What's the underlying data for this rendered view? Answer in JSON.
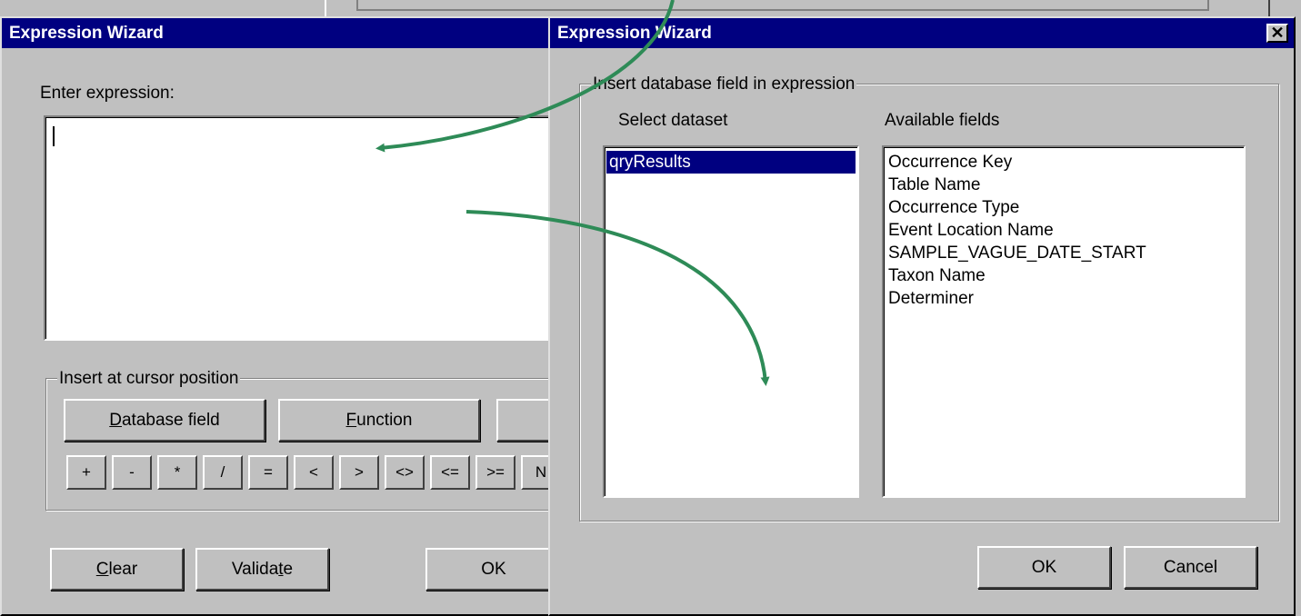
{
  "left_dialog": {
    "title": "Expression Wizard",
    "expression_label": "Enter expression:",
    "expression_value": "",
    "insert_group_caption": "Insert at cursor position",
    "database_field_button": {
      "pre": "",
      "accel": "D",
      "post": "atabase field"
    },
    "function_button": {
      "pre": "",
      "accel": "F",
      "post": "unction"
    },
    "operators": [
      "+",
      "-",
      "*",
      "/",
      "=",
      "<",
      ">",
      "<>",
      "<=",
      ">=",
      "N"
    ],
    "clear_button": {
      "pre": "",
      "accel": "C",
      "post": "lear"
    },
    "validate_button": {
      "pre": "Valida",
      "accel": "t",
      "post": "e"
    },
    "ok_button": "OK"
  },
  "right_dialog": {
    "title": "Expression Wizard",
    "close_glyph": "✕",
    "group_caption": "Insert database field in expression",
    "select_dataset_label": "Select dataset",
    "available_fields_label": "Available fields",
    "datasets": [
      "qryResults"
    ],
    "selected_dataset": "qryResults",
    "fields": [
      "Occurrence Key",
      "Table Name",
      "Occurrence Type",
      "Event Location Name",
      "SAMPLE_VAGUE_DATE_START",
      "Taxon Name",
      "Determiner"
    ],
    "ok_button": "OK",
    "cancel_button": "Cancel"
  },
  "annotation": {
    "arrow_color": "#2e8b57"
  }
}
